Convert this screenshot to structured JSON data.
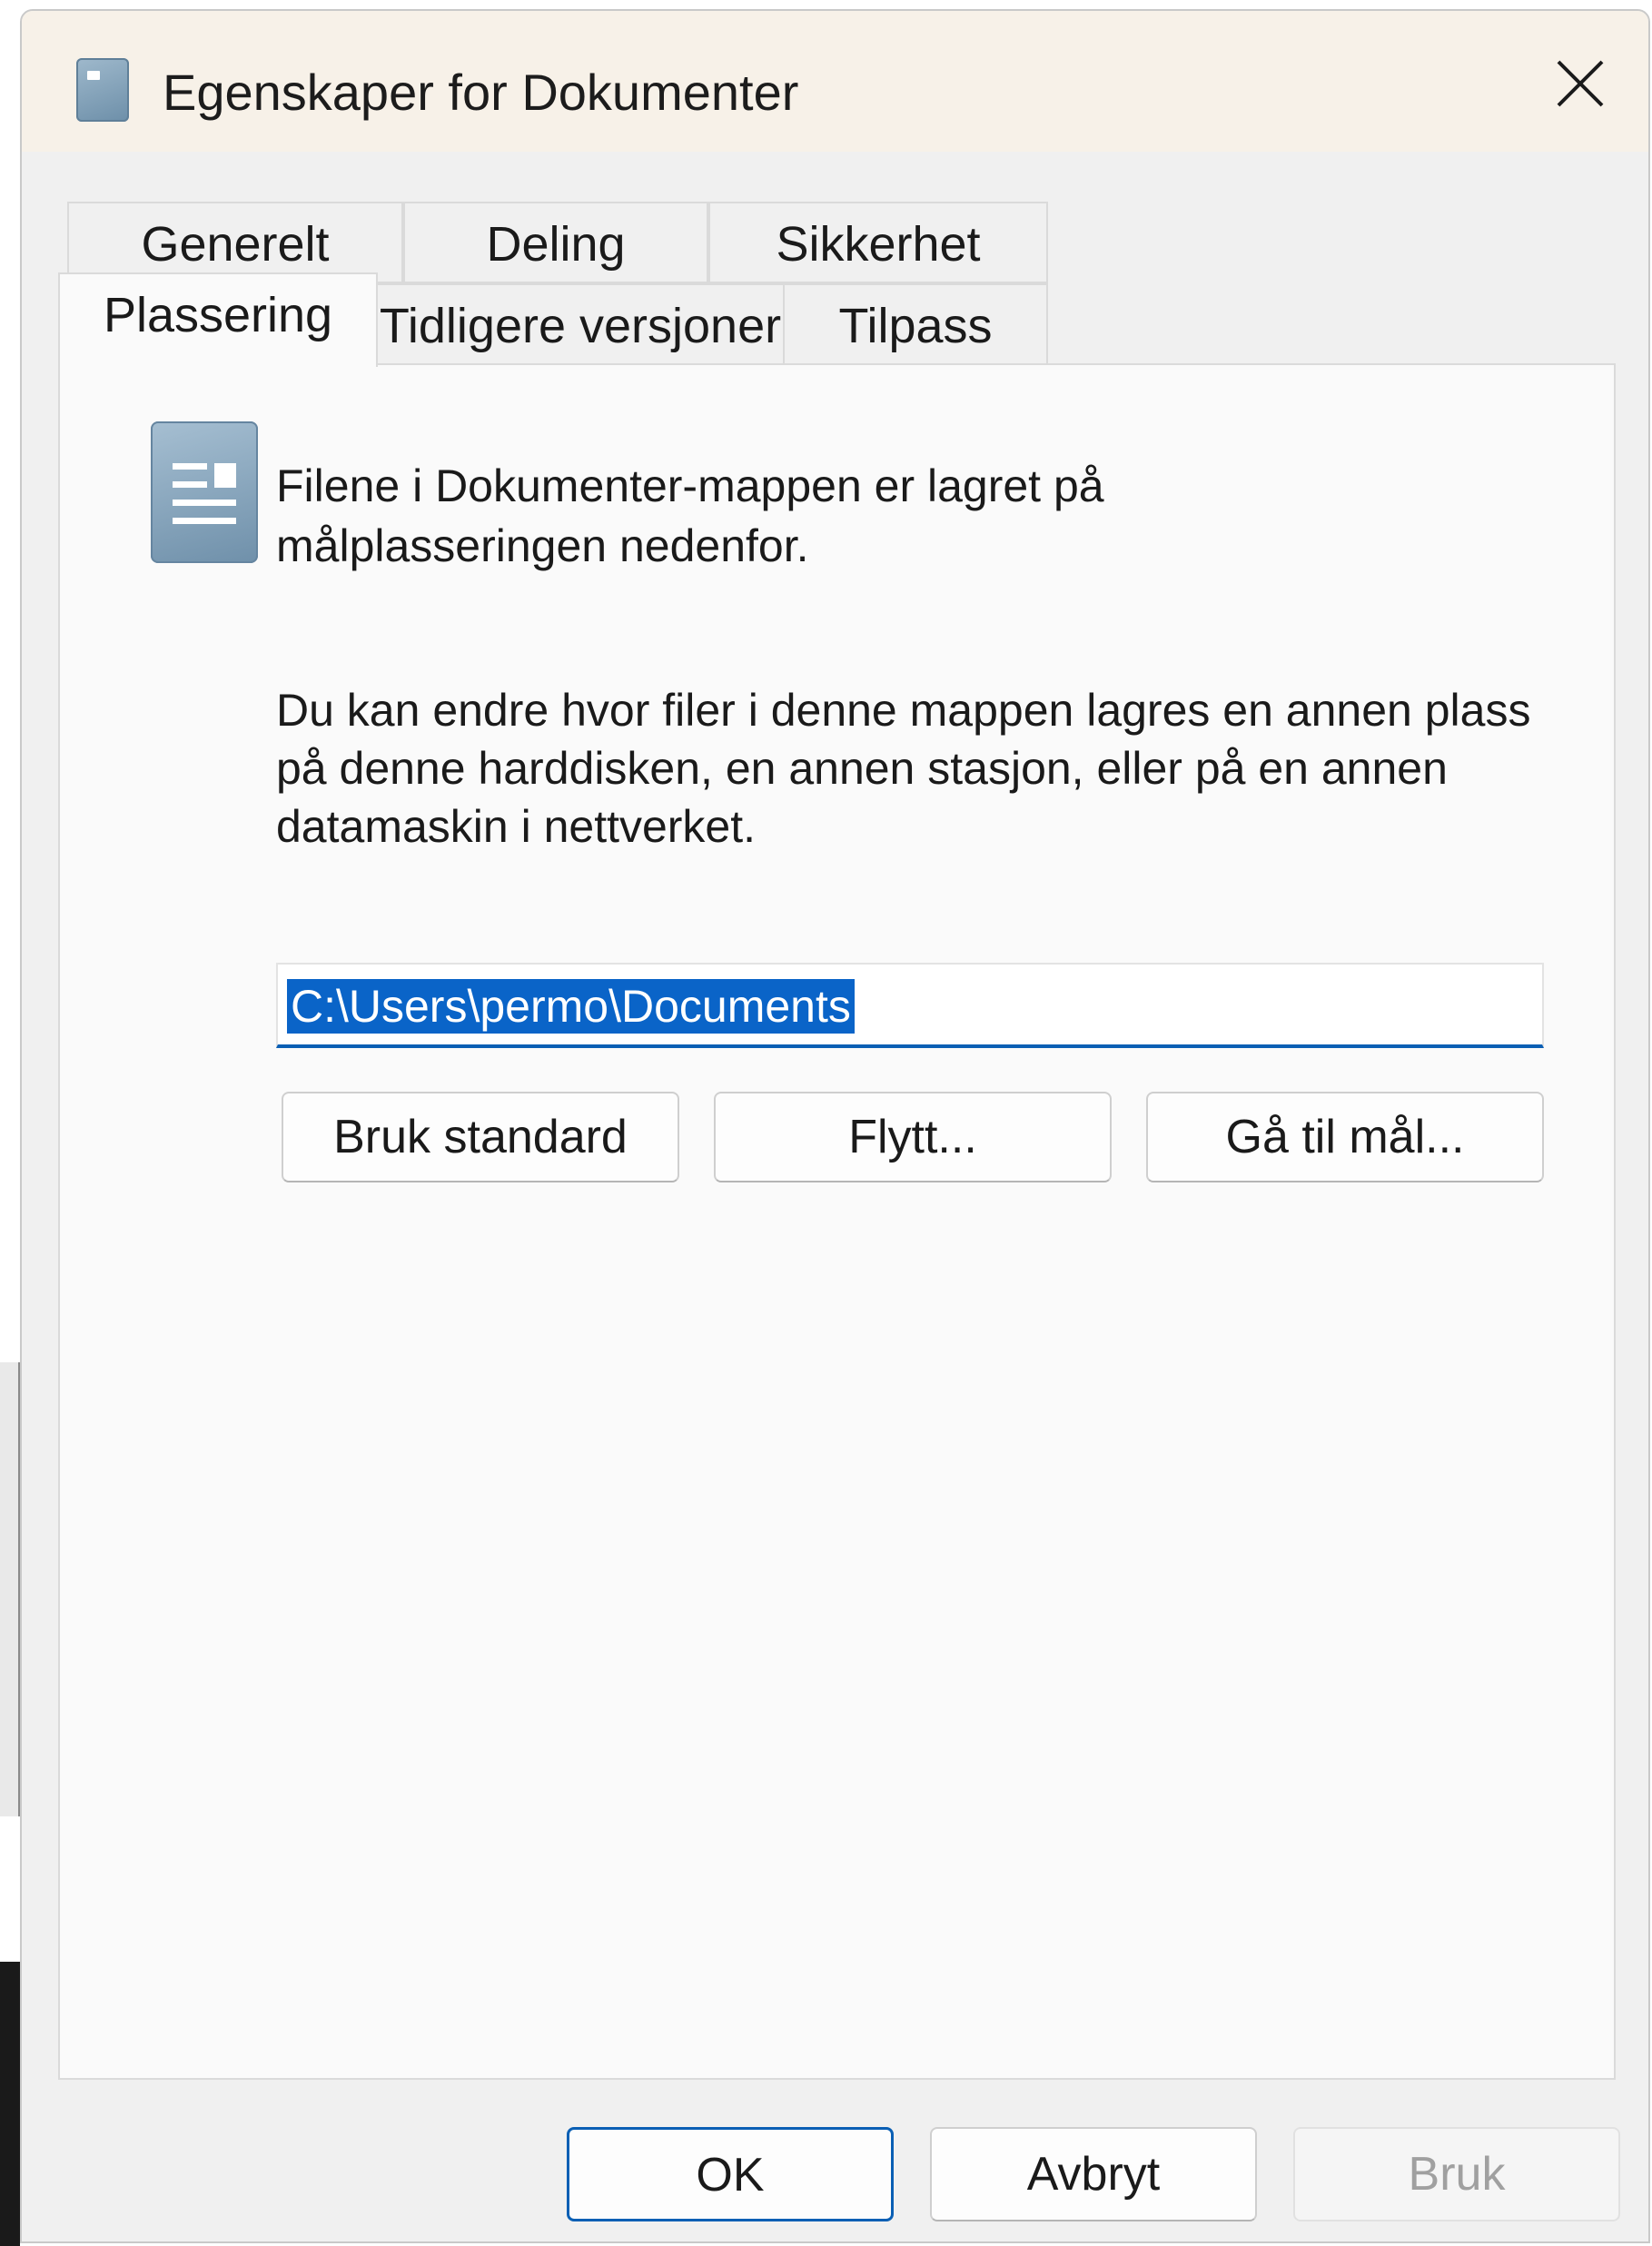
{
  "window": {
    "title": "Egenskaper for Dokumenter",
    "icon": "folder-properties-icon",
    "close_icon": "close-icon"
  },
  "tabs": {
    "row1": [
      "Generelt",
      "Deling",
      "Sikkerhet"
    ],
    "row2": [
      "Plassering",
      "Tidligere versjoner",
      "Tilpass"
    ],
    "active": "Plassering"
  },
  "location_panel": {
    "icon": "documents-folder-icon",
    "info": "Filene i Dokumenter-mappen er lagret på målplasseringen nedenfor.",
    "description": "Du kan endre hvor filer i denne mappen lagres en annen plass på denne harddisken, en annen stasjon, eller på en annen datamaskin i nettverket.",
    "path_value": "C:\\Users\\permo\\Documents",
    "path_selected": true,
    "buttons": {
      "restore_default": "Bruk standard",
      "move": "Flytt...",
      "find_target": "Gå til mål..."
    }
  },
  "footer": {
    "ok": "OK",
    "cancel": "Avbryt",
    "apply": "Bruk",
    "apply_enabled": false
  },
  "colors": {
    "accent": "#0a5fb4",
    "selection": "#0a64c8",
    "titlebar": "#f7f1e8"
  }
}
